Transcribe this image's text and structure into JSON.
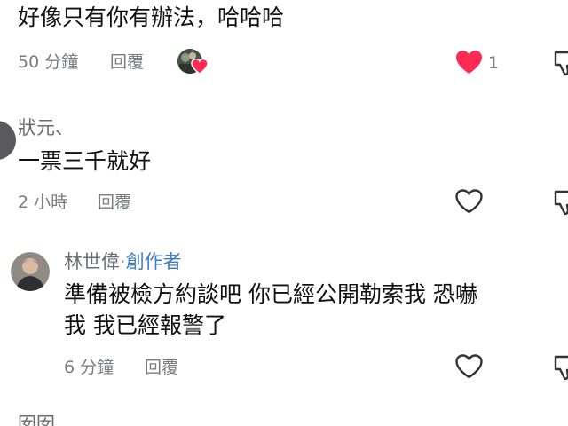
{
  "comments": [
    {
      "text": "好像只有你有辦法，哈哈哈",
      "time": "50 分鐘",
      "reply_label": "回覆",
      "like_count": "1",
      "liked": true
    },
    {
      "username": "狀元、",
      "text": "一票三千就好",
      "time": "2 小時",
      "reply_label": "回覆"
    },
    {
      "username": "林世偉",
      "dot": "·",
      "creator_label": "創作者",
      "text_line1": "準備被檢方約談吧 你已經公開勒索我 恐嚇",
      "text_line2": "我 我已經報警了",
      "time": "6 分鐘",
      "reply_label": "回覆"
    },
    {
      "username": "囡囡"
    }
  ],
  "colors": {
    "like_red": "#fe2c55",
    "creator_blue": "#3d7cc9",
    "muted": "#7a7c82"
  },
  "icons": [
    "heart-icon",
    "dislike-icon",
    "creator-avatar",
    "liker-avatar"
  ]
}
